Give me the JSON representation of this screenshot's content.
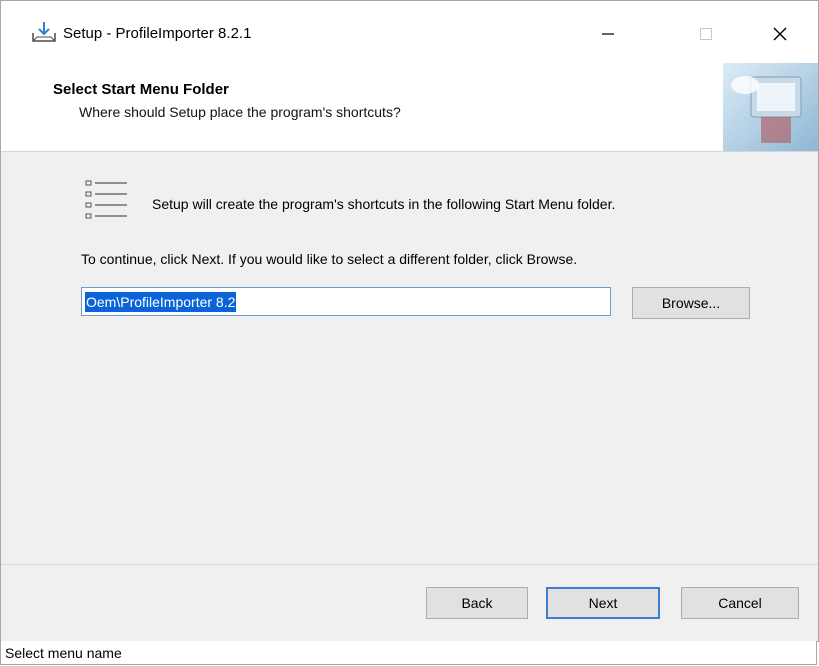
{
  "window": {
    "title": "Setup - ProfileImporter 8.2.1",
    "icon": "installer-download-icon",
    "controls": [
      "minimize-icon",
      "maximize-icon",
      "close-icon"
    ]
  },
  "header": {
    "title": "Select Start Menu Folder",
    "subtitle": "Where should Setup place the program's shortcuts?",
    "image": "computer-setup-graphic"
  },
  "body": {
    "intro": "Setup will create the program's shortcuts in the following Start Menu folder.",
    "instruction": "To continue, click Next. If you would like to select a different folder, click Browse.",
    "folder_value": "Oem\\ProfileImporter 8.2",
    "browse_label": "Browse..."
  },
  "footer": {
    "back_label": "Back",
    "next_label": "Next",
    "cancel_label": "Cancel"
  },
  "caption": "Select menu name",
  "colors": {
    "selection": "#0a64d8",
    "default_button_border": "#3c7ed3",
    "panel": "#f0f0f0"
  }
}
